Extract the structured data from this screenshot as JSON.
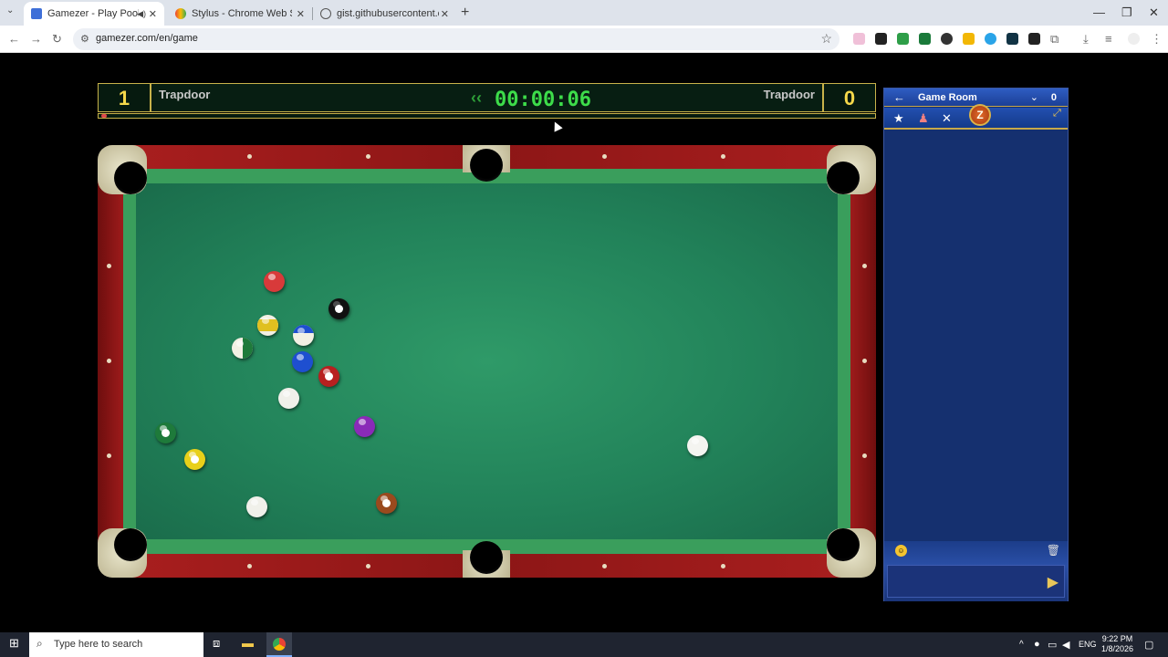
{
  "browser": {
    "tabs": [
      {
        "title": "Gamezer - Play Pool and Bi",
        "active": true
      },
      {
        "title": "Stylus - Chrome Web Store",
        "active": false
      },
      {
        "title": "gist.githubusercontent.com/Tra",
        "active": false
      }
    ],
    "url": "gamezer.com/en/game"
  },
  "game": {
    "left_score": "1",
    "left_player": "Trapdoor",
    "timer": "00:00:06",
    "right_player": "Trapdoor",
    "right_score": "0"
  },
  "panel": {
    "title": "Game Room",
    "count": "0",
    "logo_letter": "Z"
  },
  "taskbar": {
    "search_placeholder": "Type here to search",
    "lang": "ENG",
    "time": "9:22 PM",
    "date": "1/8/2026"
  },
  "colors": {
    "felt": "#22835a",
    "rail": "#a81e1e",
    "timer": "#3ddc4a",
    "score": "#f5d84a",
    "panel": "#15306f"
  }
}
